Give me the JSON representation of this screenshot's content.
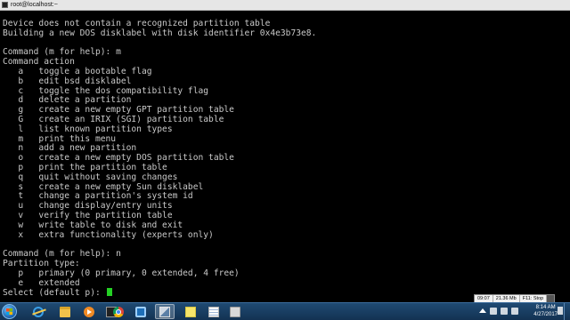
{
  "window": {
    "title": "root@localhost:~"
  },
  "terminal": {
    "lines": [
      "Device does not contain a recognized partition table",
      "Building a new DOS disklabel with disk identifier 0x4e3b73e8.",
      "",
      "Command (m for help): m",
      "Command action",
      "   a   toggle a bootable flag",
      "   b   edit bsd disklabel",
      "   c   toggle the dos compatibility flag",
      "   d   delete a partition",
      "   g   create a new empty GPT partition table",
      "   G   create an IRIX (SGI) partition table",
      "   l   list known partition types",
      "   m   print this menu",
      "   n   add a new partition",
      "   o   create a new empty DOS partition table",
      "   p   print the partition table",
      "   q   quit without saving changes",
      "   s   create a new empty Sun disklabel",
      "   t   change a partition's system id",
      "   u   change display/entry units",
      "   v   verify the partition table",
      "   w   write table to disk and exit",
      "   x   extra functionality (experts only)",
      "",
      "Command (m for help): n",
      "Partition type:",
      "   p   primary (0 primary, 0 extended, 4 free)",
      "   e   extended",
      "Select (default p): "
    ],
    "cursor_color": "#24d024"
  },
  "overlay_stats": {
    "time": "09:07",
    "size": "21.36 Mb",
    "hotkey": "F11: Stop"
  },
  "taskbar": {
    "apps": [
      {
        "icon": "internet-explorer-icon"
      },
      {
        "icon": "file-explorer-icon"
      },
      {
        "icon": "media-player-icon"
      },
      {
        "icon": "command-prompt-icon"
      },
      {
        "icon": "chrome-icon"
      },
      {
        "icon": "screen-capture-icon"
      },
      {
        "icon": "putty-icon",
        "active": true
      },
      {
        "icon": "sticky-notes-icon"
      },
      {
        "icon": "notepad-icon"
      },
      {
        "icon": "printer-icon"
      }
    ],
    "clock_time": "8:14 AM",
    "clock_date": "4/27/2017"
  }
}
